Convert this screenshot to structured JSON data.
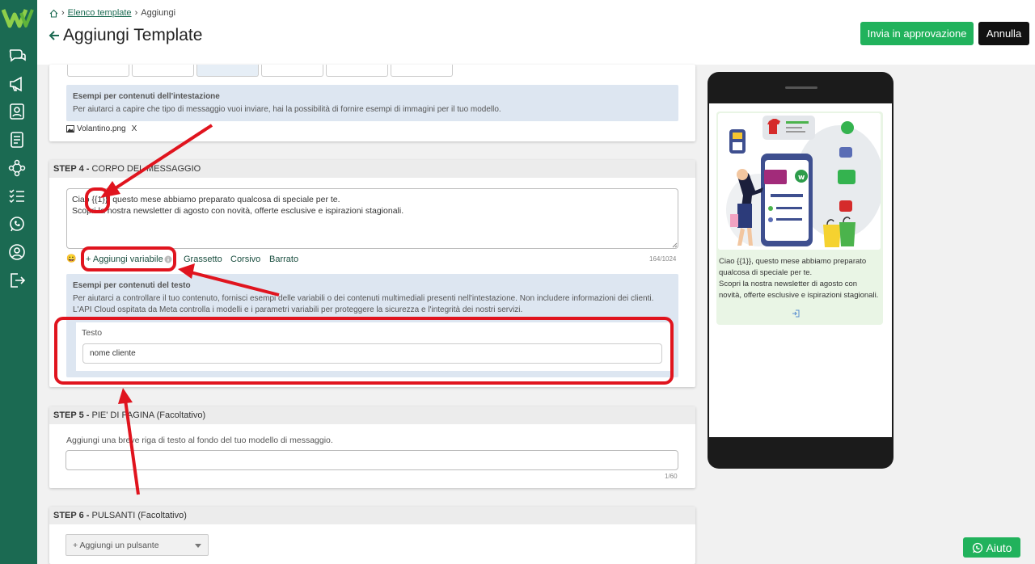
{
  "breadcrumb": {
    "home_icon": "home-icon",
    "list": "Elenco template",
    "current": "Aggiungi"
  },
  "header": {
    "title": "Aggiungi Template",
    "approve_label": "Invia in approvazione",
    "cancel_label": "Annulla"
  },
  "sidebar": {
    "icons": [
      "chat-icon",
      "megaphone-icon",
      "contacts-icon",
      "document-icon",
      "flow-icon",
      "checklist-icon",
      "whatsapp-icon",
      "user-icon",
      "logout-icon"
    ]
  },
  "header_examples": {
    "title": "Esempi per contenuti dell'intestazione",
    "description": "Per aiutarci a capire che tipo di messaggio vuoi inviare, hai la possibilità di fornire esempi di immagini per il tuo modello.",
    "file_name": "Volantino.png",
    "file_remove": "X"
  },
  "step4": {
    "number": "STEP 4 -",
    "title": "CORPO DEL MESSAGGIO",
    "body_line1": "Ciao {{1}}, questo mese abbiamo preparato qualcosa di speciale per te.",
    "body_line2": "Scopri la nostra newsletter di agosto con novità, offerte esclusive e ispirazioni stagionali.",
    "emoji": "😀",
    "add_variable": "+ Aggiungi variabile",
    "bold": "Grassetto",
    "italic": "Corsivo",
    "strike": "Barrato",
    "counter": "164/1024",
    "examples_title": "Esempi per contenuti del testo",
    "examples_line1": "Per aiutarci a controllare il tuo contenuto, fornisci esempi delle variabili o dei contenuti multimediali presenti nell'intestazione. Non includere informazioni dei clienti.",
    "examples_line2": "L'API Cloud ospitata da Meta controlla i modelli e i parametri variabili per proteggere la sicurezza e l'integrità dei nostri servizi.",
    "variable_label": "Testo",
    "variable_value": "nome cliente"
  },
  "step5": {
    "number": "STEP 5 -",
    "title": "PIE' DI PAGINA (Facoltativo)",
    "description": "Aggiungi una breve riga di testo al fondo del tuo modello di messaggio.",
    "counter": "1/60"
  },
  "step6": {
    "number": "STEP 6 -",
    "title": "PULSANTI (Facoltativo)",
    "add_button": "+ Aggiungi un pulsante"
  },
  "preview": {
    "line1": "Ciao {{1}}, questo mese abbiamo preparato qualcosa di speciale per te.",
    "line2": "Scopri la nostra newsletter di agosto con novità, offerte esclusive e ispirazioni stagionali."
  },
  "help": {
    "label": "Aiuto"
  },
  "colors": {
    "brand": "#1b6a52",
    "accent": "#21b25c",
    "annotation": "#e0141e"
  }
}
